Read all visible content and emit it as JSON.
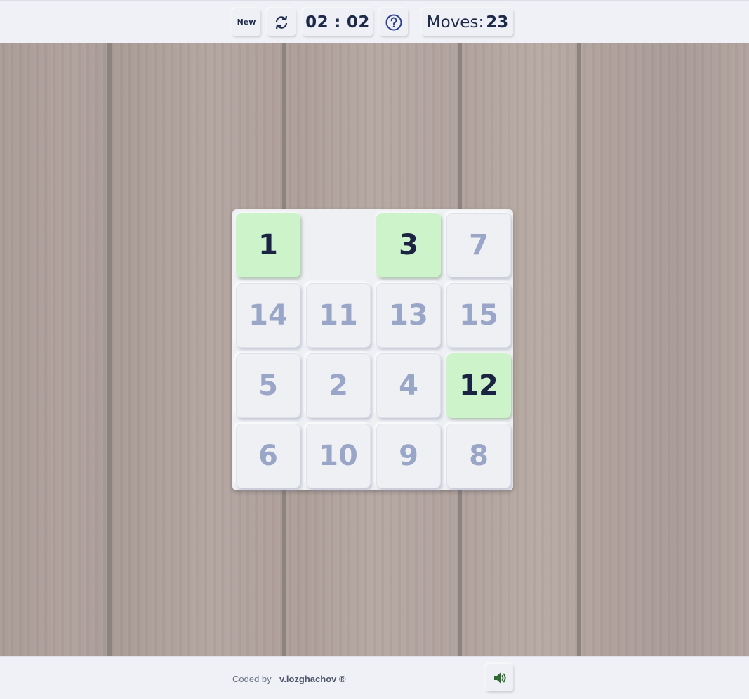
{
  "header": {
    "new_label": "New",
    "refresh_icon": "refresh-icon",
    "timer": {
      "minutes": "02",
      "separator": ":",
      "seconds": "02"
    },
    "help_icon": "help-icon",
    "moves_label": "Moves:",
    "moves_value": "23"
  },
  "board": {
    "tiles": [
      {
        "label": "1",
        "correct": true
      },
      {
        "label": "",
        "correct": false,
        "empty": true
      },
      {
        "label": "3",
        "correct": true
      },
      {
        "label": "7",
        "correct": false
      },
      {
        "label": "14",
        "correct": false
      },
      {
        "label": "11",
        "correct": false
      },
      {
        "label": "13",
        "correct": false
      },
      {
        "label": "15",
        "correct": false
      },
      {
        "label": "5",
        "correct": false
      },
      {
        "label": "2",
        "correct": false
      },
      {
        "label": "4",
        "correct": false
      },
      {
        "label": "12",
        "correct": true
      },
      {
        "label": "6",
        "correct": false
      },
      {
        "label": "10",
        "correct": false
      },
      {
        "label": "9",
        "correct": false
      },
      {
        "label": "8",
        "correct": false
      }
    ]
  },
  "footer": {
    "credit_label": "Coded by",
    "author": "v.lozghachov ®",
    "sound_icon": "speaker-icon"
  },
  "colors": {
    "correct_tile": "#cdf3cb",
    "tile_text": "#9aa6c7",
    "correct_text": "#1a2442",
    "sound_icon": "#2e6b2e"
  }
}
